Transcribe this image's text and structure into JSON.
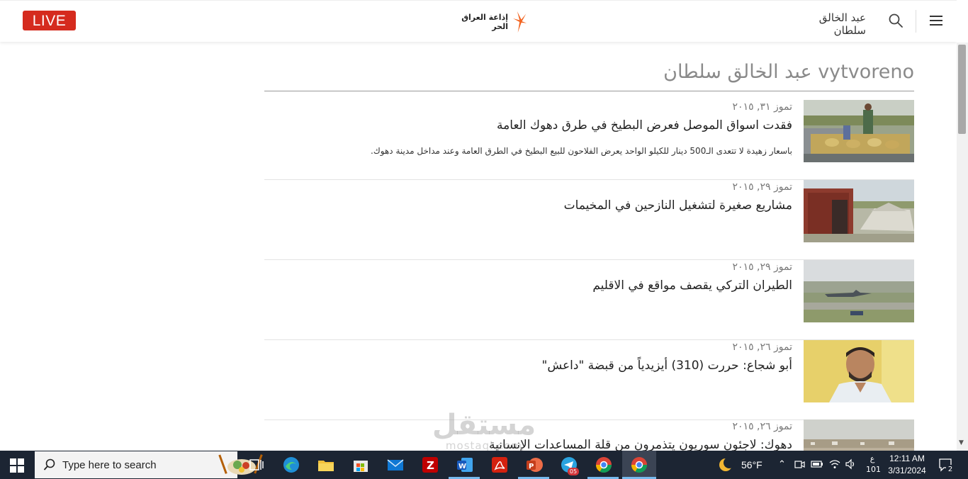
{
  "header": {
    "live_label": "LIVE",
    "logo_text": "إذاعة العراق الحر",
    "author_name": "عبد الخالق سلطان"
  },
  "page": {
    "title": "vytvoreno عبد الخالق سلطان"
  },
  "articles": [
    {
      "date": "تموز ٣١, ٢٠١٥",
      "title": "فقدت اسواق الموصل فعرض البطيخ في طرق دهوك العامة",
      "description": "باسعار زهيدة لا تتعدى الـ500 دينار للكيلو الواحد يعرض الفلاحون للبيع البطيخ في الطرق العامة وعند مداخل مدينة دهوك.",
      "thumb": "watermelon-market-photo"
    },
    {
      "date": "تموز ٢٩, ٢٠١٥",
      "title": "مشاريع صغيرة لتشغيل النازحين في المخيمات",
      "description": "",
      "thumb": "camp-tent-photo"
    },
    {
      "date": "تموز ٢٩, ٢٠١٥",
      "title": "الطيران التركي يقصف مواقع في الاقليم",
      "description": "",
      "thumb": "military-aircraft-photo"
    },
    {
      "date": "تموز ٢٦, ٢٠١٥",
      "title": "أبو شجاع: حررت (310) أيزيدياً من قبضة \"داعش\"",
      "description": "",
      "thumb": "man-portrait-photo"
    },
    {
      "date": "تموز ٢٦, ٢٠١٥",
      "title": "دهوك: لاجئون سوريون يتذمرون من قلة المساعدات الإنسانية",
      "description": "",
      "thumb": "refugee-camp-photo"
    }
  ],
  "watermark": {
    "main": "مستقل",
    "sub": "mostaql.com"
  },
  "taskbar": {
    "search_placeholder": "Type here to search",
    "weather_temp": "56°F",
    "lang_top": "ع",
    "lang_bottom": "101",
    "time": "12:11 AM",
    "date": "3/31/2024",
    "notification_count": "2",
    "telegram_badge": "05"
  },
  "colors": {
    "live_red": "#d52b1e",
    "logo_orange": "#f26522",
    "taskbar_bg": "#1c2533"
  }
}
